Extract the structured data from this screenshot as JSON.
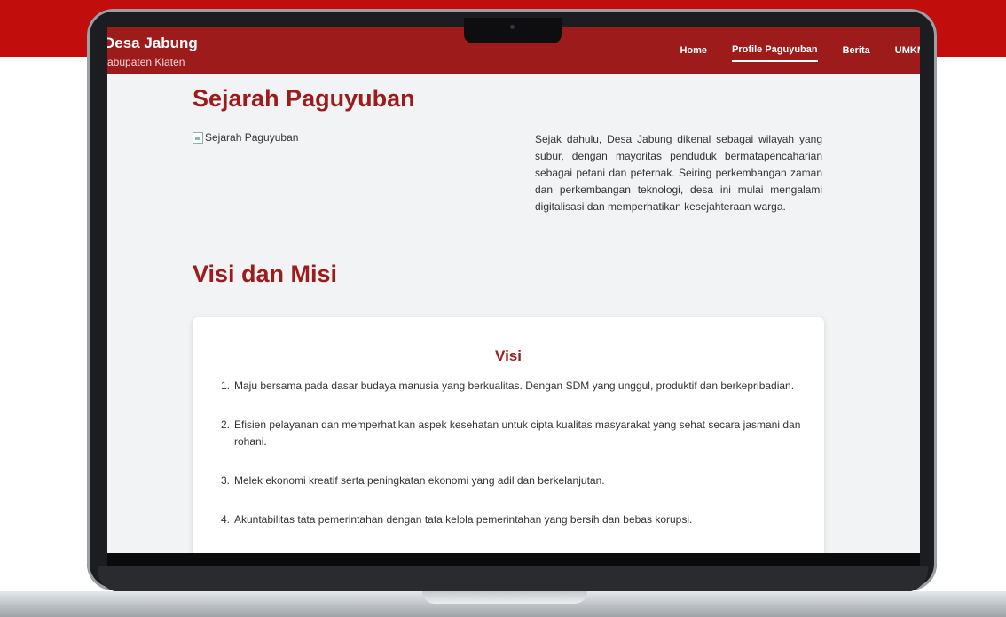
{
  "site": {
    "name": "Desa Jabung",
    "subtitle": "Kabupaten Klaten"
  },
  "nav": {
    "items": [
      {
        "label": "Home",
        "active": false
      },
      {
        "label": "Profile Paguyuban",
        "active": true
      },
      {
        "label": "Berita",
        "active": false
      },
      {
        "label": "UMKM",
        "active": false
      }
    ]
  },
  "sejarah": {
    "title": "Sejarah Paguyuban",
    "image_alt": "Sejarah Paguyuban",
    "text": "Sejak dahulu, Desa Jabung dikenal sebagai wilayah yang subur, dengan mayoritas penduduk bermatapencaharian sebagai petani dan peternak. Seiring perkembangan zaman dan perkembangan teknologi, desa ini mulai mengalami digitalisasi dan memperhatikan kesejahteraan warga."
  },
  "visi_misi": {
    "title": "Visi dan Misi",
    "visi_title": "Visi",
    "visi_items": [
      {
        "num": "1.",
        "text": "Maju bersama pada dasar budaya manusia yang berkualitas. Dengan SDM yang unggul, produktif dan berkepribadian."
      },
      {
        "num": "2.",
        "text": "Efisien pelayanan dan memperhatikan aspek kesehatan untuk cipta kualitas masyarakat yang sehat secara jasmani dan rohani."
      },
      {
        "num": "3.",
        "text": "Melek ekonomi kreatif serta peningkatan ekonomi yang adil dan berkelanjutan."
      },
      {
        "num": "4.",
        "text": "Akuntabilitas tata pemerintahan dengan tata kelola pemerintahan yang bersih dan bebas korupsi."
      }
    ]
  },
  "colors": {
    "brand_red": "#9e1b1b",
    "band_red": "#c20d0d"
  }
}
